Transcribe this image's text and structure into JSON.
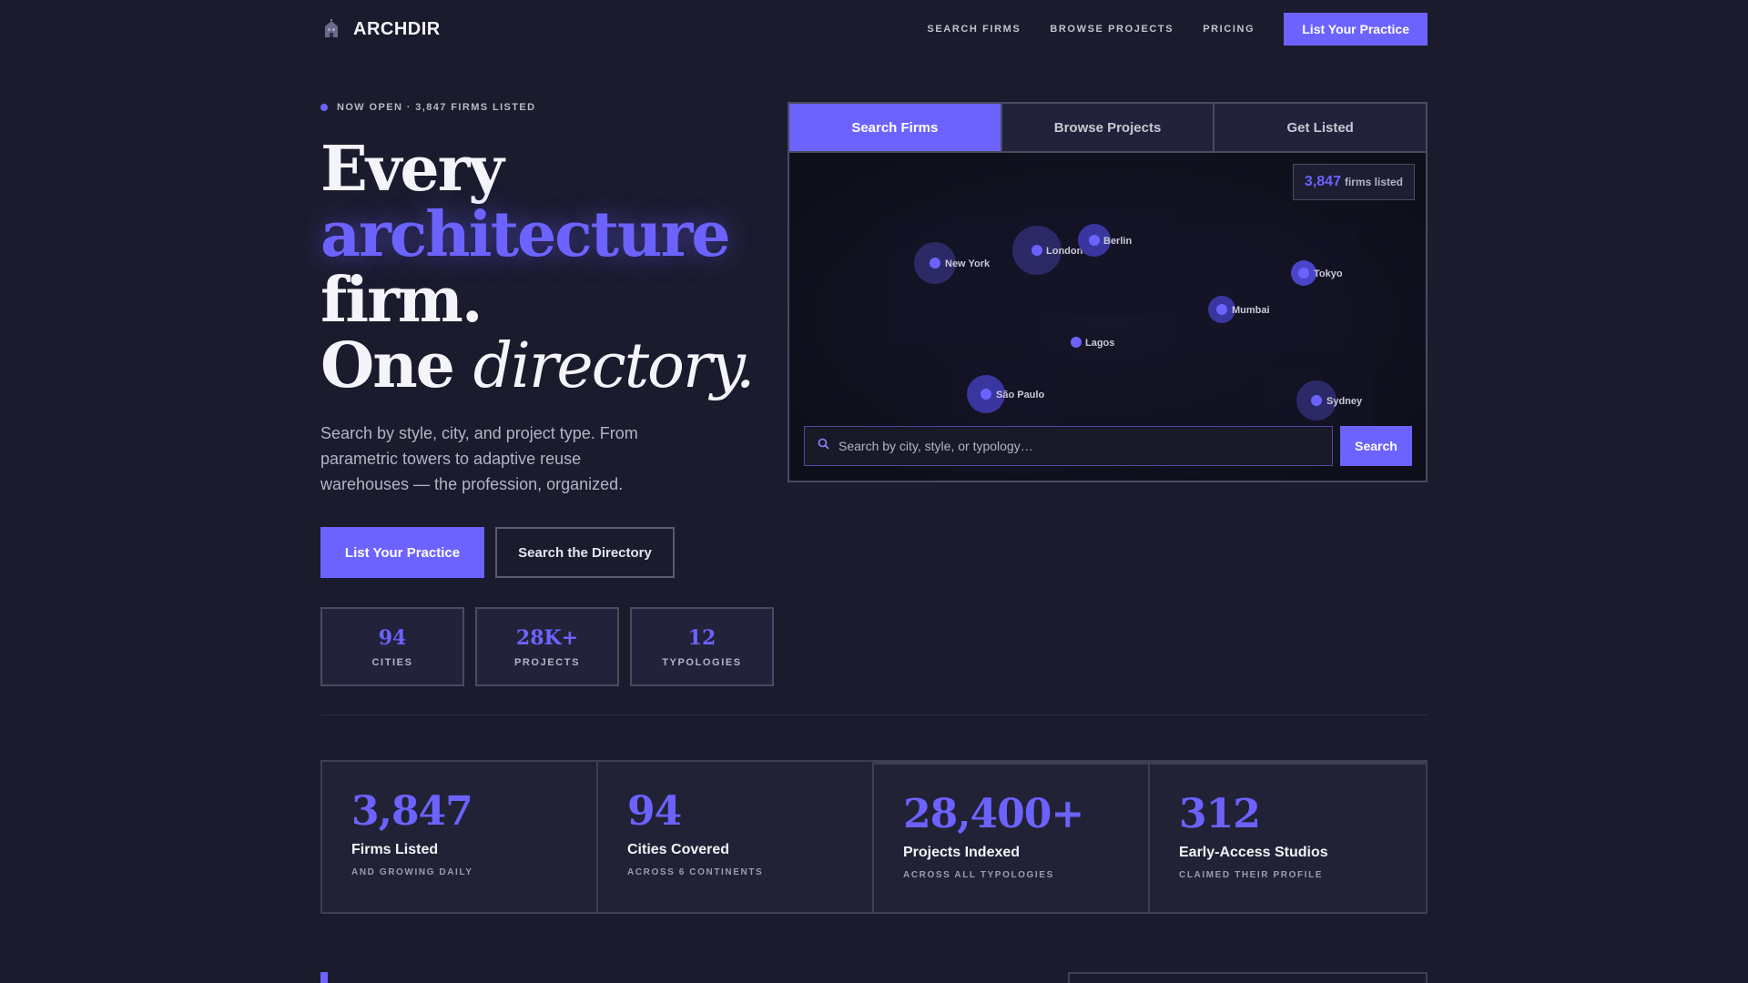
{
  "nav": {
    "brand": "ARCHDIR",
    "links": [
      "SEARCH FIRMS",
      "BROWSE PROJECTS",
      "PRICING"
    ],
    "cta": "List Your Practice"
  },
  "hero": {
    "eyebrow": "NOW OPEN · 3,847 FIRMS LISTED",
    "headline": {
      "line1": "Every",
      "line2": "architecture",
      "line3": "firm.",
      "line4a": "One",
      "line4b": "directory."
    },
    "lede": "Search by style, city, and project type. From parametric towers to adaptive reuse warehouses — the profession, organized.",
    "primary_cta": "List Your Practice",
    "secondary_cta": "Search the Directory",
    "mini_stats": [
      {
        "value": "94",
        "label": "CITIES"
      },
      {
        "value": "28K+",
        "label": "PROJECTS"
      },
      {
        "value": "12",
        "label": "TYPOLOGIES"
      }
    ]
  },
  "panel": {
    "tabs": [
      "Search Firms",
      "Browse Projects",
      "Get Listed"
    ],
    "active_tab": "Search Firms",
    "badge_number": "3,847",
    "badge_label": "firms listed",
    "cities": [
      "New York",
      "London",
      "Berlin",
      "Tokyo",
      "Mumbai",
      "Lagos",
      "São Paulo",
      "Sydney"
    ],
    "search_placeholder": "Search by city, style, or typology…",
    "search_button": "Search"
  },
  "stats": [
    {
      "value": "3,847",
      "title": "Firms Listed",
      "sub": "AND GROWING DAILY"
    },
    {
      "value": "94",
      "title": "Cities Covered",
      "sub": "ACROSS 6 CONTINENTS"
    },
    {
      "value": "28,400+",
      "title": "Projects Indexed",
      "sub": "ACROSS ALL TYPOLOGIES"
    },
    {
      "value": "312",
      "title": "Early-Access Studios",
      "sub": "CLAIMED THEIR PROFILE"
    }
  ],
  "colors": {
    "background": "#1b1b2e",
    "accent": "#6c63ff",
    "panel": "#22223a",
    "border": "#4a4a60"
  },
  "icons": [
    "building-logo-icon",
    "search-icon"
  ]
}
